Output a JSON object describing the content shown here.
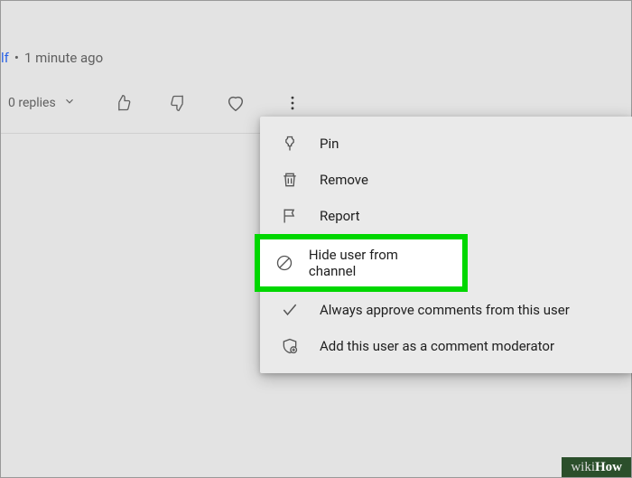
{
  "comment": {
    "username_fragment": "lf",
    "dot": "•",
    "timestamp": "1 minute ago",
    "replies_label": "0 replies"
  },
  "menu": {
    "pin": "Pin",
    "remove": "Remove",
    "report": "Report",
    "hide": "Hide user from channel",
    "approve": "Always approve comments from this user",
    "moderator": "Add this user as a comment moderator"
  },
  "watermark": {
    "part1": "wiki",
    "part2": "How"
  }
}
